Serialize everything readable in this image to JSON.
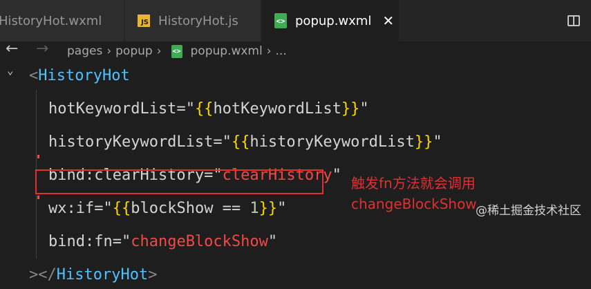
{
  "tabs": [
    {
      "label": "HistoryHot.wxml",
      "icon": "wxml-file-icon",
      "active": false
    },
    {
      "label": "HistoryHot.js",
      "icon": "js-file-icon",
      "active": false
    },
    {
      "label": "popup.wxml",
      "icon": "wxml-file-icon",
      "active": true
    }
  ],
  "icons": {
    "js_text": "JS",
    "wx_text": "<>",
    "close": "✕"
  },
  "breadcrumb": {
    "items": [
      "pages",
      "popup",
      "popup.wxml",
      "..."
    ]
  },
  "code": {
    "line1": {
      "open": "<",
      "tag": "HistoryHot"
    },
    "line2": {
      "attr": "hotKeywordList",
      "eq": "=",
      "q1": "\"",
      "b1": "{{",
      "val": "hotKeywordList",
      "b2": "}}",
      "q2": "\""
    },
    "line3": {
      "attr": "historyKeywordList",
      "eq": "=",
      "q1": "\"",
      "b1": "{{",
      "val": "historyKeywordList",
      "b2": "}}",
      "q2": "\""
    },
    "line4": {
      "attr": "bind:clearHistory",
      "eq": "=",
      "q1": "\"",
      "val": "clearHistory",
      "q2": "\""
    },
    "line5": {
      "attr": "wx:if",
      "eq": "=",
      "q1": "\"",
      "b1": "{{",
      "expr": "blockShow == ",
      "num": "1",
      "b2": "}}",
      "q2": "\""
    },
    "line6": {
      "attr": "bind:fn",
      "eq": "=",
      "q1": "\"",
      "val": "changeBlockShow",
      "q2": "\""
    },
    "line7": {
      "close": "></",
      "tag": "HistoryHot",
      "end": ">"
    }
  },
  "annotation": {
    "line1": "触发fn方法就会调用",
    "line2": "changeBlockShow"
  },
  "watermark": "@稀土掘金技术社区",
  "colors": {
    "accent_red": "#e03030",
    "tag_blue": "#4fc1ff",
    "brace_yellow": "#ffd700",
    "string_red": "#f44747"
  }
}
